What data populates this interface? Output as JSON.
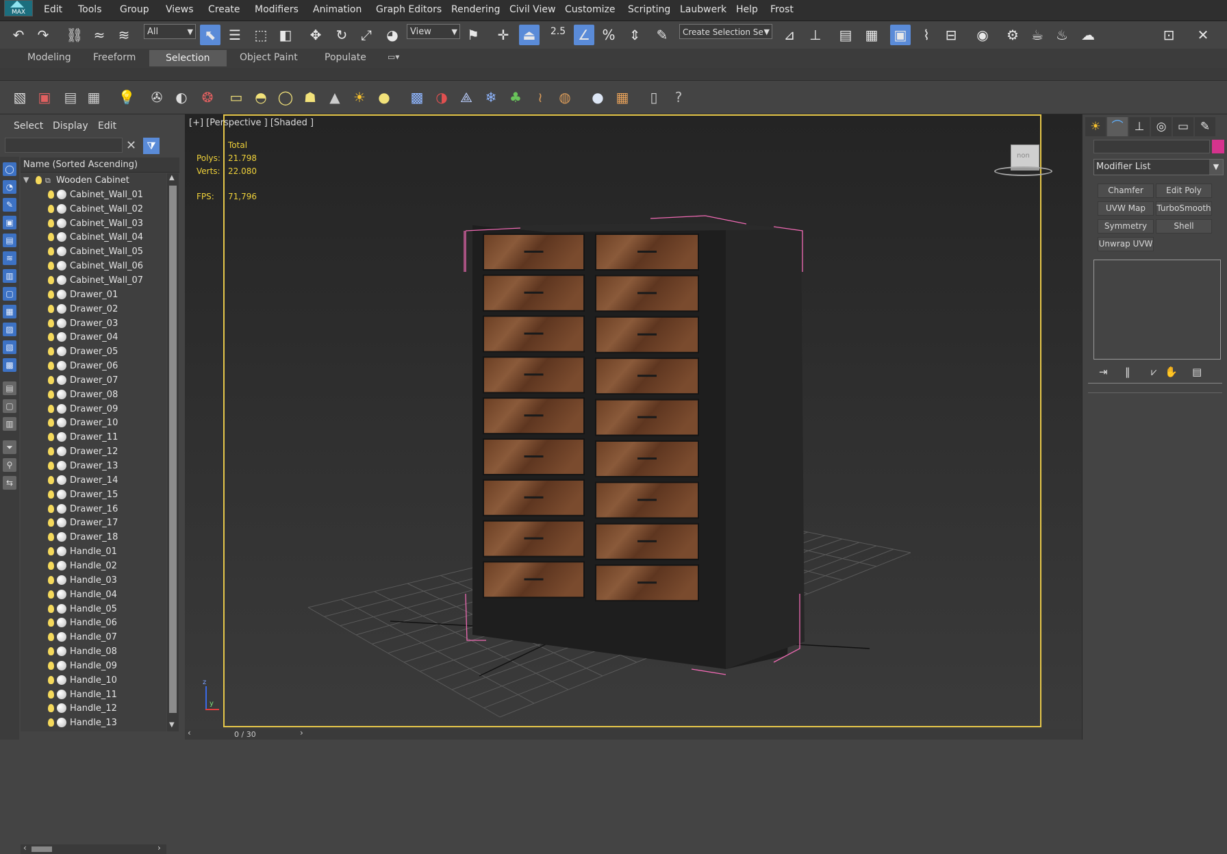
{
  "menu": {
    "logo_text": "MAX",
    "items": [
      "Edit",
      "Tools",
      "Group",
      "Views",
      "Create",
      "Modifiers",
      "Animation",
      "Graph Editors",
      "Rendering",
      "Civil View",
      "Customize",
      "Scripting",
      "Laubwerk",
      "Help",
      "Frost"
    ]
  },
  "toolbar": {
    "selection_filter": "All",
    "reference_coord": "View",
    "snap_value": "2.5",
    "selection_set_placeholder": "Create Selection Se"
  },
  "ribbon": {
    "tabs": [
      "Modeling",
      "Freeform",
      "Selection",
      "Object Paint",
      "Populate"
    ],
    "selected": "Selection"
  },
  "explorer": {
    "tabs": [
      "Select",
      "Display",
      "Edit"
    ],
    "column_header": "Name (Sorted Ascending)",
    "root": "Wooden Cabinet",
    "items": [
      "Cabinet_Wall_01",
      "Cabinet_Wall_02",
      "Cabinet_Wall_03",
      "Cabinet_Wall_04",
      "Cabinet_Wall_05",
      "Cabinet_Wall_06",
      "Cabinet_Wall_07",
      "Drawer_01",
      "Drawer_02",
      "Drawer_03",
      "Drawer_04",
      "Drawer_05",
      "Drawer_06",
      "Drawer_07",
      "Drawer_08",
      "Drawer_09",
      "Drawer_10",
      "Drawer_11",
      "Drawer_12",
      "Drawer_13",
      "Drawer_14",
      "Drawer_15",
      "Drawer_16",
      "Drawer_17",
      "Drawer_18",
      "Handle_01",
      "Handle_02",
      "Handle_03",
      "Handle_04",
      "Handle_05",
      "Handle_06",
      "Handle_07",
      "Handle_08",
      "Handle_09",
      "Handle_10",
      "Handle_11",
      "Handle_12",
      "Handle_13"
    ]
  },
  "viewport": {
    "label": "[+] [Perspective ] [Shaded ]",
    "stats": {
      "total_label": "Total",
      "polys_label": "Polys:",
      "polys_value": "21.798",
      "verts_label": "Verts:",
      "verts_value": "22.080",
      "fps_label": "FPS:",
      "fps_value": "71,796"
    },
    "viewcube_label": "non"
  },
  "timeline": {
    "frame": "0 / 30"
  },
  "command_panel": {
    "modifier_list": "Modifier List",
    "modifier_buttons": [
      "Chamfer",
      "Edit Poly",
      "UVW Map",
      "TurboSmooth",
      "Symmetry",
      "Shell",
      "Unwrap UVW"
    ],
    "object_color": "#d6338d"
  },
  "colors": {
    "accent_blue": "#5a8bd8",
    "viewport_border": "#e7c84a",
    "stats_text": "#f0d23a",
    "selection_bracket": "#f06ab4"
  }
}
